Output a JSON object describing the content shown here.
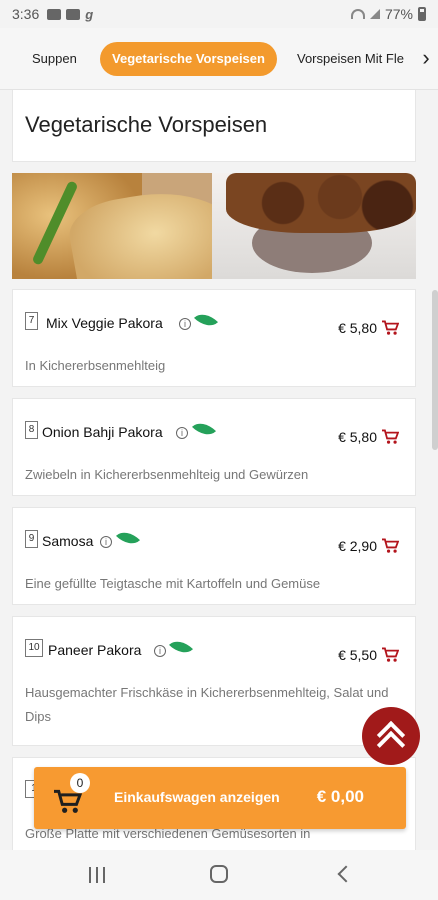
{
  "status_bar": {
    "time": "3:36",
    "battery": "77%"
  },
  "tabs": [
    {
      "label": "Suppen"
    },
    {
      "label": "Vegetarische Vorspeisen",
      "active": true
    },
    {
      "label": "Vorspeisen Mit Fle"
    }
  ],
  "section": {
    "title": "Vegetarische Vorspeisen"
  },
  "items": [
    {
      "number": "7",
      "name": "Mix Veggie Pakora",
      "vegetarian": true,
      "price": "€ 5,80",
      "description": "In Kichererbsenmehlteig"
    },
    {
      "number": "8",
      "name": "Onion Bahji Pakora",
      "vegetarian": true,
      "price": "€ 5,80",
      "description": "Zwiebeln in Kichererbsenmehlteig und Gewürzen"
    },
    {
      "number": "9",
      "name": "Samosa",
      "vegetarian": true,
      "price": "€ 2,90",
      "description": "Eine gefüllte Teigtasche mit Kartoffeln und Gemüse"
    },
    {
      "number": "10",
      "name": "Paneer Pakora",
      "vegetarian": true,
      "price": "€ 5,50",
      "description": "Hausgemachter Frischkäse in Kichererbsenmehlteig, Salat und Dips"
    },
    {
      "number": "1",
      "name": "",
      "vegetarian": false,
      "price": "",
      "description": "Große Platte mit verschiedenen Gemüsesorten in"
    }
  ],
  "info_glyph": "i",
  "cart": {
    "count": "0",
    "label": "Einkaufswagen anzeigen",
    "total": "€ 0,00"
  },
  "colors": {
    "accent": "#f39a2d",
    "cart_bar": "#f79a31",
    "fab": "#a11a1a",
    "cart_icon": "#b3141c",
    "leaf": "#25a15a"
  },
  "icons": {
    "cart": "shopping-cart-icon",
    "leaf": "vegetarian-leaf-icon",
    "info": "info-icon",
    "scroll_up": "double-chevron-up-icon"
  }
}
